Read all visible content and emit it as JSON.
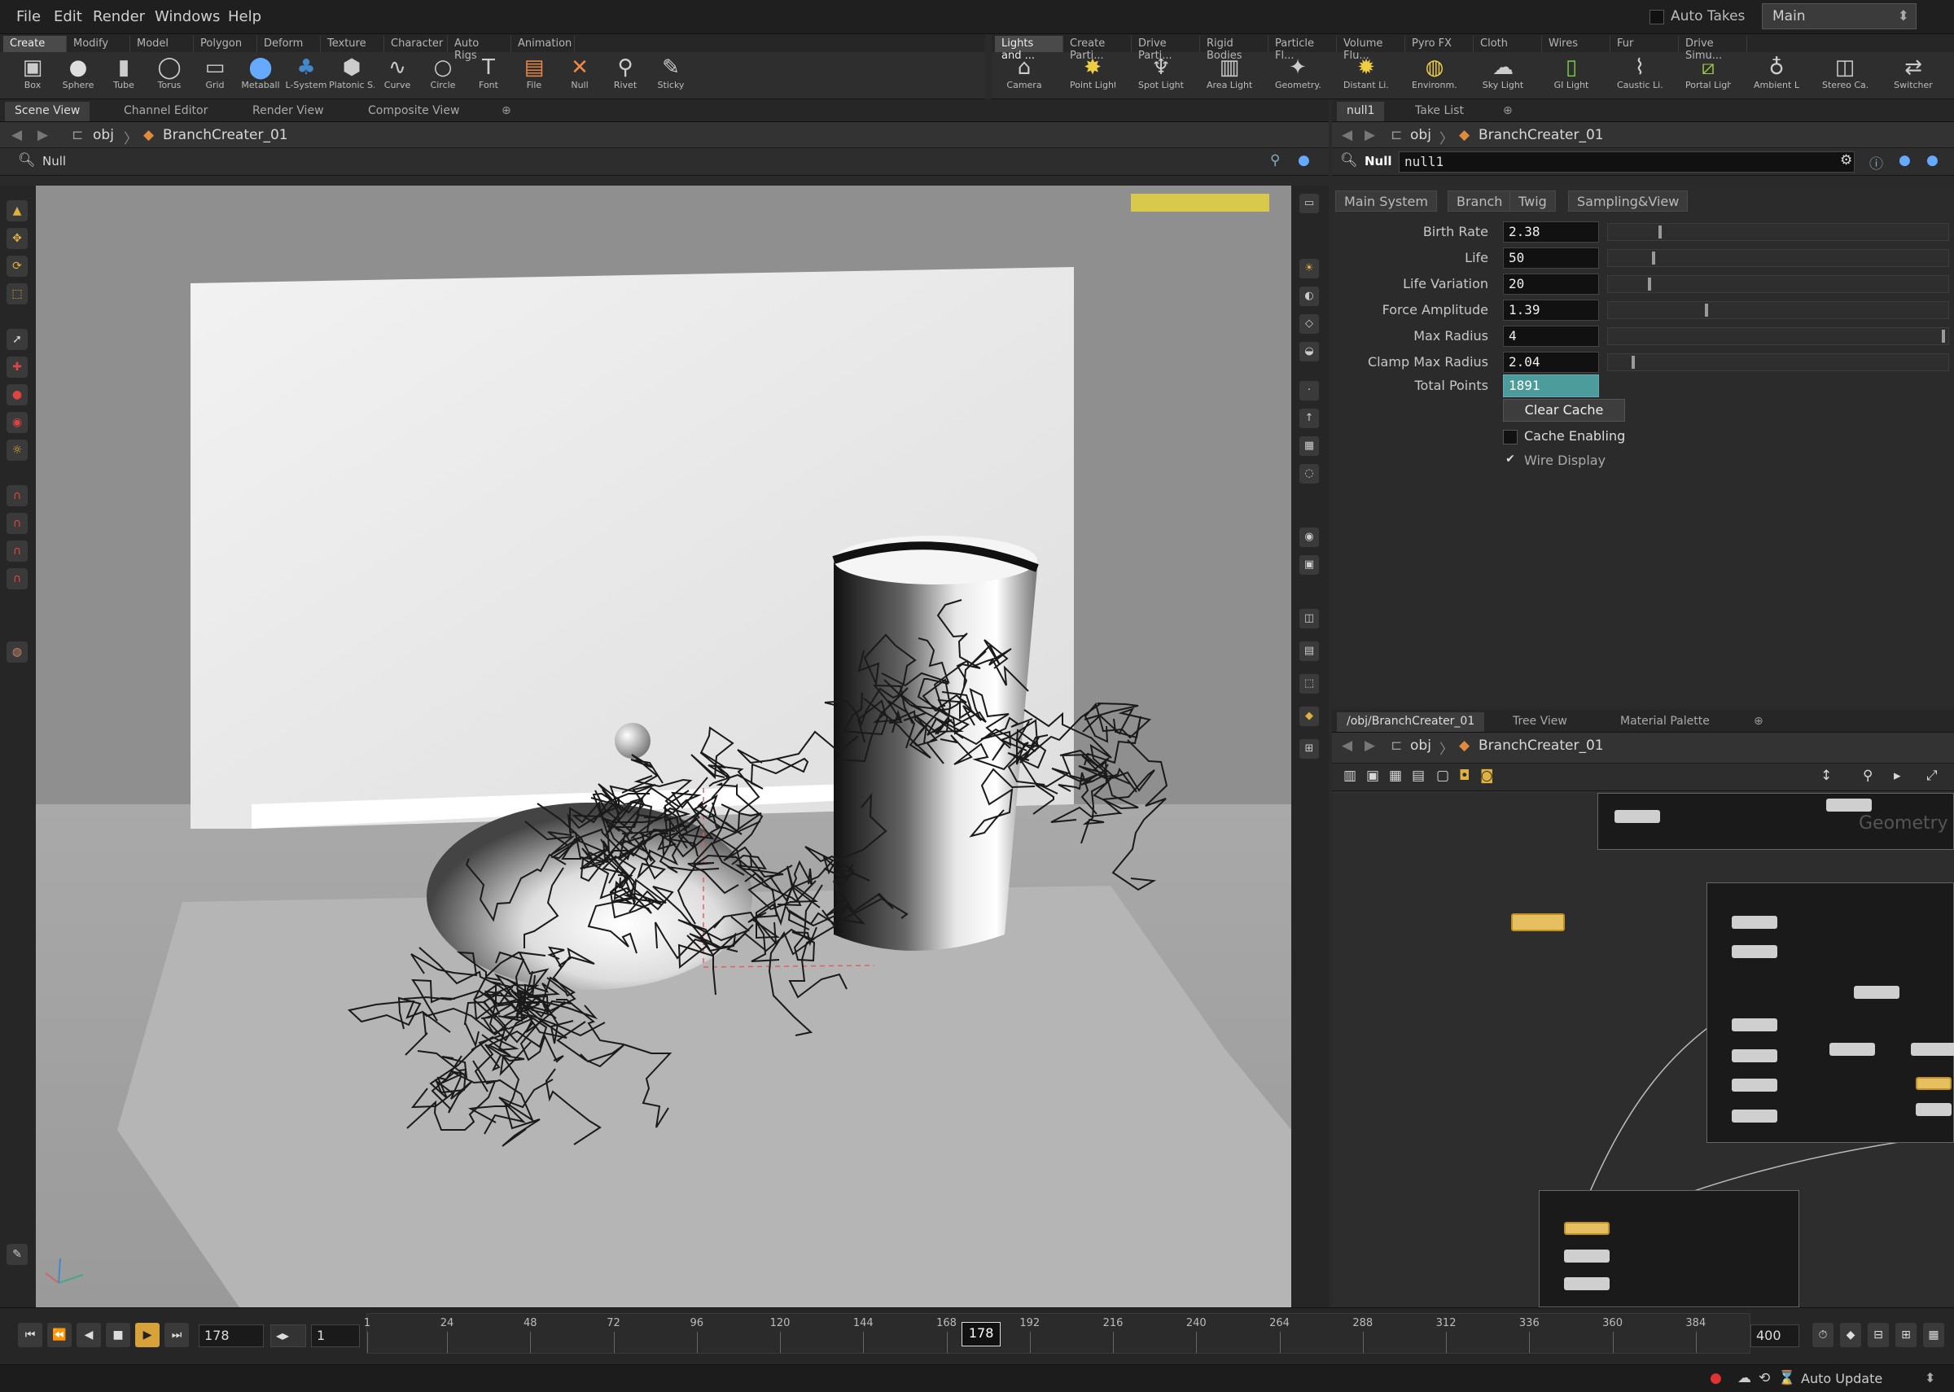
{
  "menu": [
    "File",
    "Edit",
    "Render",
    "Windows",
    "Help"
  ],
  "auto_takes": "Auto Takes",
  "take": "Main",
  "shelf_left": {
    "tabs": [
      "Create",
      "Modify",
      "Model",
      "Polygon",
      "Deform",
      "Texture",
      "Character",
      "Auto Rigs",
      "Animation"
    ],
    "tools": [
      {
        "label": "Box",
        "icon": "cube-icon"
      },
      {
        "label": "Sphere",
        "icon": "sphere-icon"
      },
      {
        "label": "Tube",
        "icon": "tube-icon"
      },
      {
        "label": "Torus",
        "icon": "torus-icon"
      },
      {
        "label": "Grid",
        "icon": "grid-icon"
      },
      {
        "label": "Metaball",
        "icon": "metaball-icon"
      },
      {
        "label": "L-System",
        "icon": "lsystem-icon"
      },
      {
        "label": "Platonic S...",
        "icon": "platonic-icon"
      },
      {
        "label": "Curve",
        "icon": "curve-icon"
      },
      {
        "label": "Circle",
        "icon": "circle-icon"
      },
      {
        "label": "Font",
        "icon": "font-icon"
      },
      {
        "label": "File",
        "icon": "file-icon"
      },
      {
        "label": "Null",
        "icon": "null-icon"
      },
      {
        "label": "Rivet",
        "icon": "rivet-icon"
      },
      {
        "label": "Sticky",
        "icon": "sticky-icon"
      }
    ]
  },
  "shelf_right": {
    "tabs": [
      "Lights and ...",
      "Create Parti...",
      "Drive Parti...",
      "Rigid Bodies",
      "Particle Fl...",
      "Volume Flu...",
      "Pyro FX",
      "Cloth",
      "Wires",
      "Fur",
      "Drive Simu..."
    ],
    "tools": [
      {
        "label": "Camera",
        "icon": "camera-icon"
      },
      {
        "label": "Point Light",
        "icon": "point-light-icon"
      },
      {
        "label": "Spot Light",
        "icon": "spot-light-icon"
      },
      {
        "label": "Area Light",
        "icon": "area-light-icon"
      },
      {
        "label": "Geometry...",
        "icon": "geometry-light-icon"
      },
      {
        "label": "Distant Li...",
        "icon": "distant-light-icon"
      },
      {
        "label": "Environm...",
        "icon": "environment-light-icon"
      },
      {
        "label": "Sky Light",
        "icon": "sky-light-icon"
      },
      {
        "label": "GI Light",
        "icon": "gi-light-icon"
      },
      {
        "label": "Caustic Li...",
        "icon": "caustic-light-icon"
      },
      {
        "label": "Portal Light",
        "icon": "portal-light-icon"
      },
      {
        "label": "Ambient L...",
        "icon": "ambient-light-icon"
      },
      {
        "label": "Stereo Ca...",
        "icon": "stereo-camera-icon"
      },
      {
        "label": "Switcher",
        "icon": "switcher-icon"
      }
    ]
  },
  "left_pane": {
    "tabs": [
      "Scene View",
      "Channel Editor",
      "Render View",
      "Composite View"
    ],
    "path_root": "obj",
    "path_node": "BranchCreater_01",
    "header_label": "Null"
  },
  "right_pane": {
    "tabs": [
      "null1",
      "Take List"
    ],
    "path_root": "obj",
    "path_node": "BranchCreater_01",
    "node_type": "Null",
    "node_name": "null1"
  },
  "params": {
    "tabs": [
      "Main System",
      "Branch",
      "Twig",
      "Sampling&View"
    ],
    "rows": [
      {
        "label": "Birth Rate",
        "value": "2.38",
        "frac": 0.15
      },
      {
        "label": "Life",
        "value": "50",
        "frac": 0.13
      },
      {
        "label": "Life Variation",
        "value": "20",
        "frac": 0.12
      },
      {
        "label": "Force Amplitude",
        "value": "1.39",
        "frac": 0.29
      },
      {
        "label": "Max Radius",
        "value": "4",
        "frac": 1.0
      },
      {
        "label": "Clamp Max Radius",
        "value": "2.04",
        "frac": 0.07
      }
    ],
    "total_points_label": "Total Points",
    "total_points": "1891",
    "clear_cache": "Clear Cache",
    "cache_enabling": "Cache Enabling",
    "cache_enabling_checked": false,
    "wire_display": "Wire Display",
    "wire_display_checked": true
  },
  "net_pane": {
    "tabs": [
      "/obj/BranchCreater_01",
      "Tree View",
      "Material Palette"
    ],
    "path_root": "obj",
    "path_node": "BranchCreater_01",
    "watermark": "Geometry"
  },
  "timeline": {
    "start": "1",
    "frame": "178",
    "end": "400",
    "field_frame": "178",
    "field_step": "1",
    "ticks": [
      "1",
      "24",
      "48",
      "72",
      "96",
      "120",
      "144",
      "168",
      "192",
      "216",
      "240",
      "264",
      "288",
      "312",
      "336",
      "360",
      "384"
    ],
    "range_start": 1,
    "range_end": 400
  },
  "status": {
    "auto_update": "Auto Update"
  },
  "colors": {
    "accent": "#d8a23a",
    "total_points_bg": "#4c9c9c",
    "viewport_bg": "#6f6f6f"
  }
}
